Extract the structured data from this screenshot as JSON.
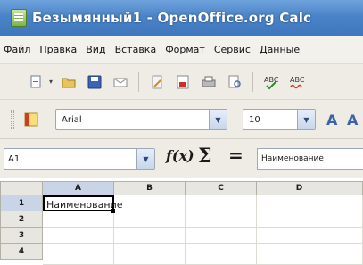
{
  "window": {
    "title": "Безымянный1 - OpenOffice.org Calc"
  },
  "menubar": {
    "items": [
      "Файл",
      "Правка",
      "Вид",
      "Вставка",
      "Формат",
      "Сервис",
      "Данные"
    ]
  },
  "toolbar_standard": {
    "buttons": [
      "new-icon",
      "open-icon",
      "save-icon",
      "email-icon",
      "edit-file-icon",
      "export-pdf-icon",
      "print-icon",
      "page-preview-icon",
      "spellcheck-icon",
      "autospellcheck-icon"
    ]
  },
  "toolbar_formatting": {
    "font_name": "Arial",
    "font_size": "10",
    "buttons": [
      "styles-icon",
      "bold-a-icon",
      "italic-a-icon"
    ]
  },
  "formula_bar": {
    "name_box": "A1",
    "function_wizard": "f(x)",
    "sum_symbol": "Σ",
    "equals_symbol": "=",
    "input_line": "Наименование"
  },
  "sheet": {
    "columns": [
      "A",
      "B",
      "C",
      "D"
    ],
    "rows": [
      "1",
      "2",
      "3",
      "4"
    ],
    "cells": {
      "A1": "Наименование"
    },
    "active_cell": "A1"
  },
  "colors": {
    "title_bar": "#4a84c8",
    "selection_header": "#c9d5e6",
    "sheet_header": "#e8e6e0"
  }
}
